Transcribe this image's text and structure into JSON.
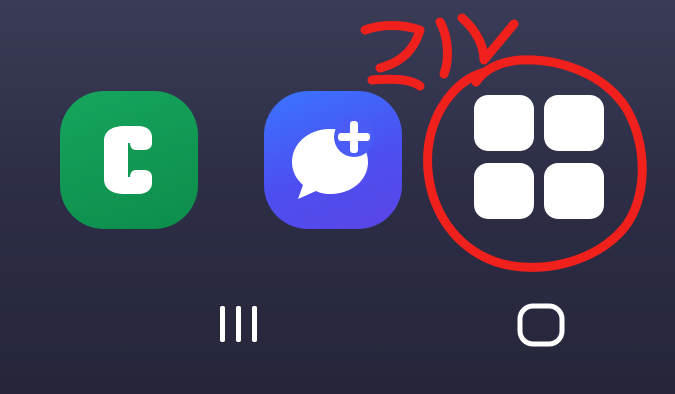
{
  "dock": {
    "apps": [
      {
        "name": "phone",
        "icon": "phone-handset-icon",
        "color": "#0f9a55"
      },
      {
        "name": "messages",
        "icon": "chat-bubble-plus-icon",
        "color": "#4a5cf5"
      },
      {
        "name": "apps",
        "icon": "four-squares-grid-icon",
        "color": "#ffffff"
      }
    ]
  },
  "annotation": {
    "color": "#f0201c",
    "shape": "freehand-circle-with-scribble"
  },
  "navbar": {
    "buttons": [
      {
        "name": "recents",
        "icon": "three-bars-icon"
      },
      {
        "name": "home",
        "icon": "rounded-square-icon"
      }
    ]
  },
  "theme": {
    "background_top": "#3a3b56",
    "background_bottom": "#25263a"
  }
}
